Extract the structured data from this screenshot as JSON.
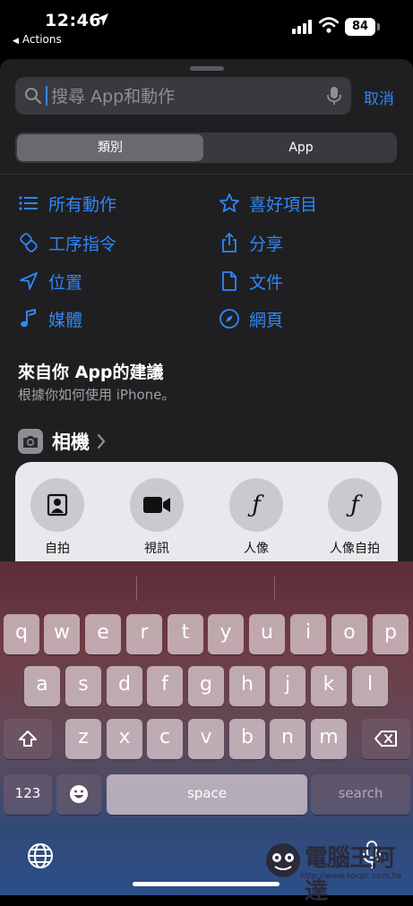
{
  "status": {
    "time": "12:46",
    "back_app": "Actions",
    "battery": "84"
  },
  "search": {
    "placeholder": "搜尋 App和動作",
    "cancel": "取消"
  },
  "segments": {
    "categories": "類別",
    "app": "App",
    "selected": "類別"
  },
  "categories": [
    {
      "label": "所有動作",
      "icon": "list-icon"
    },
    {
      "label": "喜好項目",
      "icon": "star-icon"
    },
    {
      "label": "工序指令",
      "icon": "shortcuts-icon"
    },
    {
      "label": "分享",
      "icon": "share-icon"
    },
    {
      "label": "位置",
      "icon": "location-arrow-icon"
    },
    {
      "label": "文件",
      "icon": "document-icon"
    },
    {
      "label": "媒體",
      "icon": "music-note-icon"
    },
    {
      "label": "網頁",
      "icon": "compass-icon"
    }
  ],
  "suggestions": {
    "title": "來自你 App的建議",
    "subtitle": "根據你如何使用 iPhone。",
    "app_name": "相機",
    "actions": [
      {
        "label": "自拍",
        "icon": "selfie-portrait-icon"
      },
      {
        "label": "視訊",
        "icon": "video-camera-icon"
      },
      {
        "label": "人像",
        "icon": "f-aperture-icon"
      },
      {
        "label": "人像自拍",
        "icon": "f-aperture-icon"
      }
    ]
  },
  "keyboard": {
    "row1": [
      "q",
      "w",
      "e",
      "r",
      "t",
      "y",
      "u",
      "i",
      "o",
      "p"
    ],
    "row2": [
      "a",
      "s",
      "d",
      "f",
      "g",
      "h",
      "j",
      "k",
      "l"
    ],
    "row3": [
      "z",
      "x",
      "c",
      "v",
      "b",
      "n",
      "m"
    ],
    "numbers": "123",
    "space": "space",
    "return": "search"
  },
  "watermark": {
    "text": "電腦王阿達",
    "url": "http://www.kocpc.com.tw"
  },
  "colors": {
    "accent": "#2f87f7",
    "sheet": "#1f1f21",
    "card": "#e9e9ed"
  }
}
